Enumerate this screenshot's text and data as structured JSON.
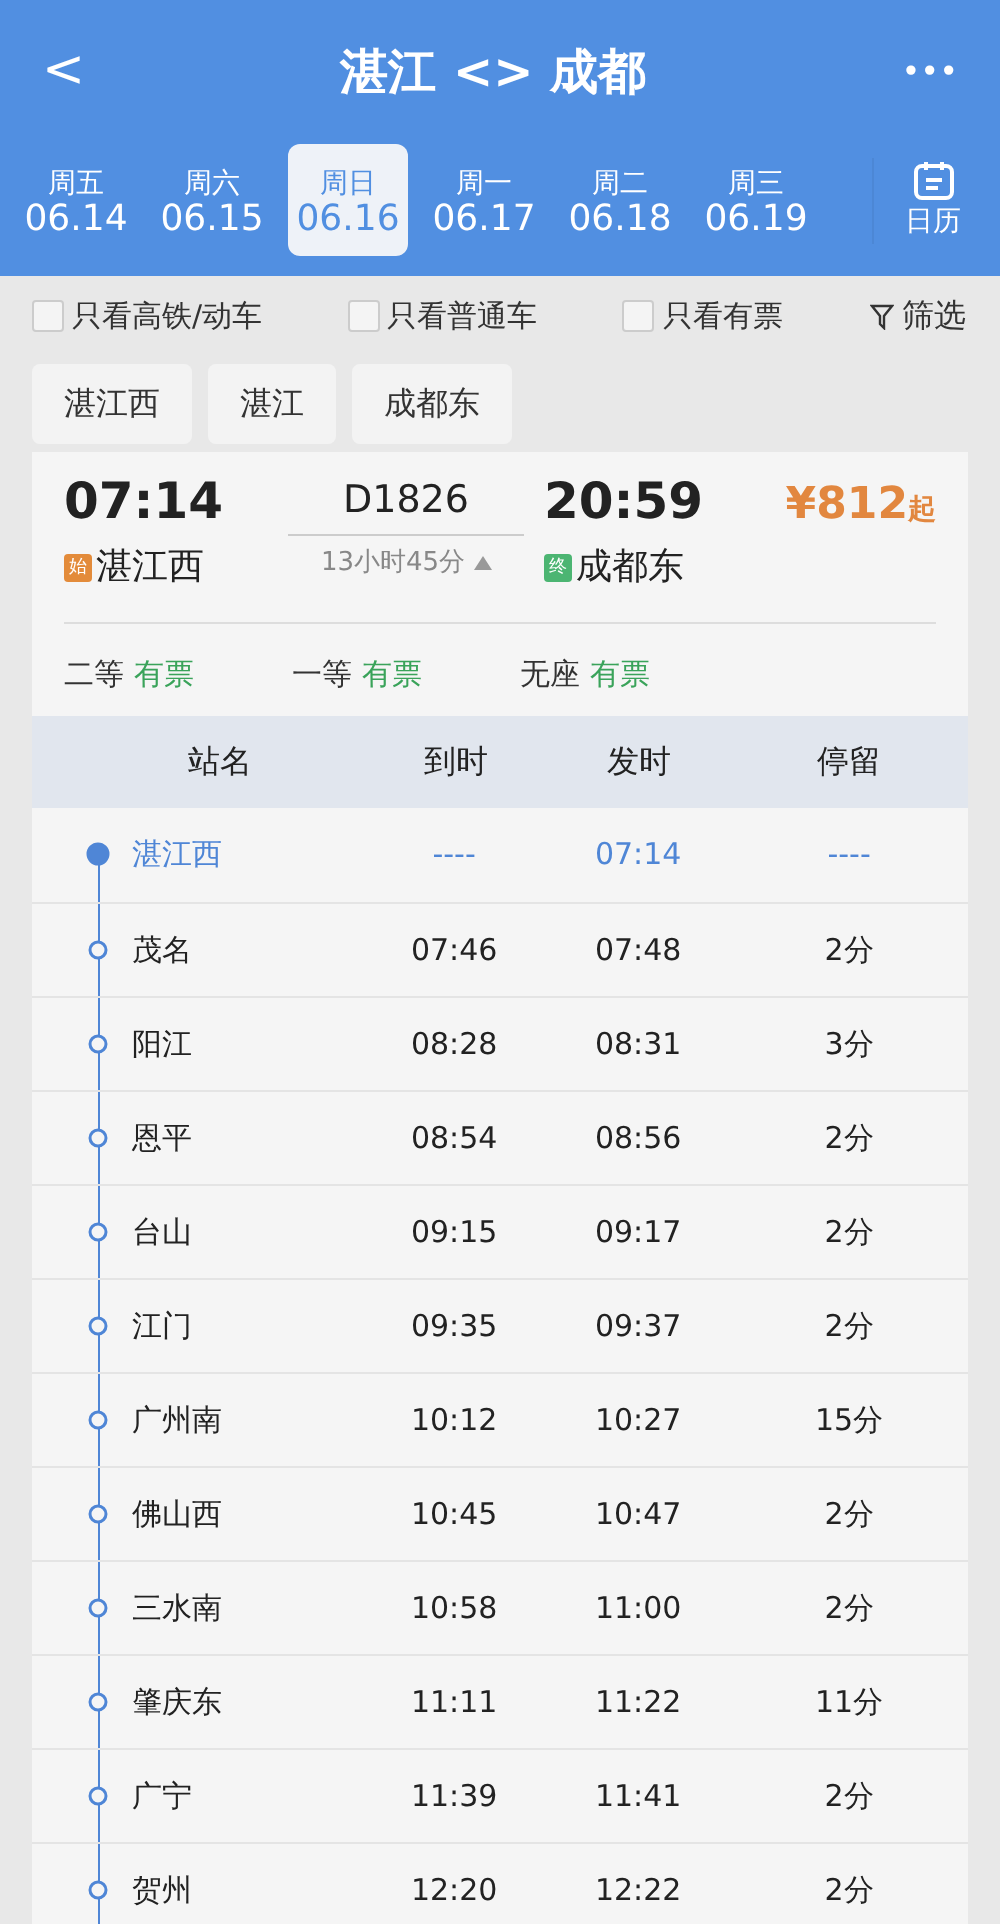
{
  "header": {
    "back": "<",
    "title": "湛江 <> 成都",
    "more": "•••"
  },
  "dates": [
    {
      "weekday": "周五",
      "date": "06.14",
      "selected": false
    },
    {
      "weekday": "周六",
      "date": "06.15",
      "selected": false
    },
    {
      "weekday": "周日",
      "date": "06.16",
      "selected": true
    },
    {
      "weekday": "周一",
      "date": "06.17",
      "selected": false
    },
    {
      "weekday": "周二",
      "date": "06.18",
      "selected": false
    },
    {
      "weekday": "周三",
      "date": "06.19",
      "selected": false
    }
  ],
  "calendar_label": "日历",
  "filters": [
    {
      "label": "只看高铁/动车",
      "checked": false
    },
    {
      "label": "只看普通车",
      "checked": false
    },
    {
      "label": "只看有票",
      "checked": false
    }
  ],
  "filter_button": "筛选",
  "station_chips": [
    "湛江西",
    "湛江",
    "成都东"
  ],
  "train": {
    "depart_time": "07:14",
    "number": "D1826",
    "arrive_time": "20:59",
    "price": "¥812",
    "price_suffix": "起",
    "from_badge": "始",
    "from": "湛江西",
    "duration": "13小时45分",
    "to_badge": "终",
    "to": "成都东",
    "seats": [
      {
        "class": "二等",
        "status": "有票"
      },
      {
        "class": "一等",
        "status": "有票"
      },
      {
        "class": "无座",
        "status": "有票"
      }
    ]
  },
  "table": {
    "columns": [
      "站名",
      "到时",
      "发时",
      "停留"
    ],
    "rows": [
      {
        "station": "湛江西",
        "arrive": "----",
        "depart": "07:14",
        "stop": "----",
        "highlighted": true
      },
      {
        "station": "茂名",
        "arrive": "07:46",
        "depart": "07:48",
        "stop": "2分",
        "highlighted": false
      },
      {
        "station": "阳江",
        "arrive": "08:28",
        "depart": "08:31",
        "stop": "3分",
        "highlighted": false
      },
      {
        "station": "恩平",
        "arrive": "08:54",
        "depart": "08:56",
        "stop": "2分",
        "highlighted": false
      },
      {
        "station": "台山",
        "arrive": "09:15",
        "depart": "09:17",
        "stop": "2分",
        "highlighted": false
      },
      {
        "station": "江门",
        "arrive": "09:35",
        "depart": "09:37",
        "stop": "2分",
        "highlighted": false
      },
      {
        "station": "广州南",
        "arrive": "10:12",
        "depart": "10:27",
        "stop": "15分",
        "highlighted": false
      },
      {
        "station": "佛山西",
        "arrive": "10:45",
        "depart": "10:47",
        "stop": "2分",
        "highlighted": false
      },
      {
        "station": "三水南",
        "arrive": "10:58",
        "depart": "11:00",
        "stop": "2分",
        "highlighted": false
      },
      {
        "station": "肇庆东",
        "arrive": "11:11",
        "depart": "11:22",
        "stop": "11分",
        "highlighted": false
      },
      {
        "station": "广宁",
        "arrive": "11:39",
        "depart": "11:41",
        "stop": "2分",
        "highlighted": false
      },
      {
        "station": "贺州",
        "arrive": "12:20",
        "depart": "12:22",
        "stop": "2分",
        "highlighted": false
      }
    ]
  }
}
